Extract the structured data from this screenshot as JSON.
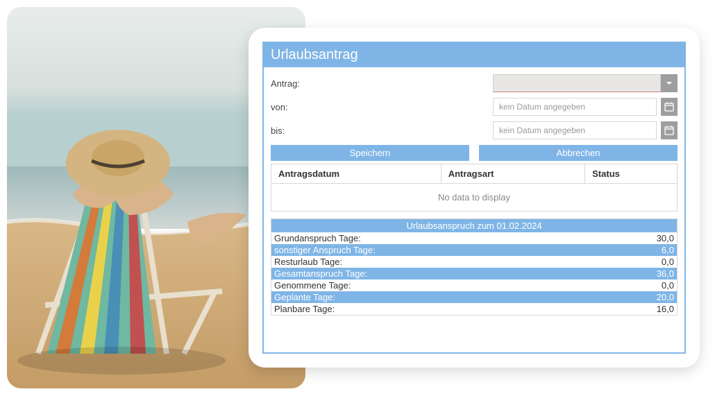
{
  "title": "Urlaubsantrag",
  "fields": {
    "antrag_label": "Antrag:",
    "von_label": "von:",
    "bis_label": "bis:",
    "von_placeholder": "kein Datum angegeben",
    "bis_placeholder": "kein Datum angegeben"
  },
  "buttons": {
    "save": "Speichern",
    "cancel": "Abbrechen"
  },
  "grid": {
    "col1": "Antragsdatum",
    "col2": "Antragsart",
    "col3": "Status",
    "empty": "No data to display"
  },
  "summary": {
    "title": "Urlaubsanspruch zum 01.02.2024",
    "rows": [
      {
        "label": "Grundanspruch Tage:",
        "value": "30,0"
      },
      {
        "label": "sonstiger Anspruch Tage:",
        "value": "6,0"
      },
      {
        "label": "Resturlaub Tage:",
        "value": "0,0"
      },
      {
        "label": "Gesamtanspruch Tage:",
        "value": "36,0"
      },
      {
        "label": "Genommene Tage:",
        "value": "0,0"
      },
      {
        "label": "Geplante Tage:",
        "value": "20,0"
      },
      {
        "label": "Planbare Tage:",
        "value": "16,0"
      }
    ]
  }
}
